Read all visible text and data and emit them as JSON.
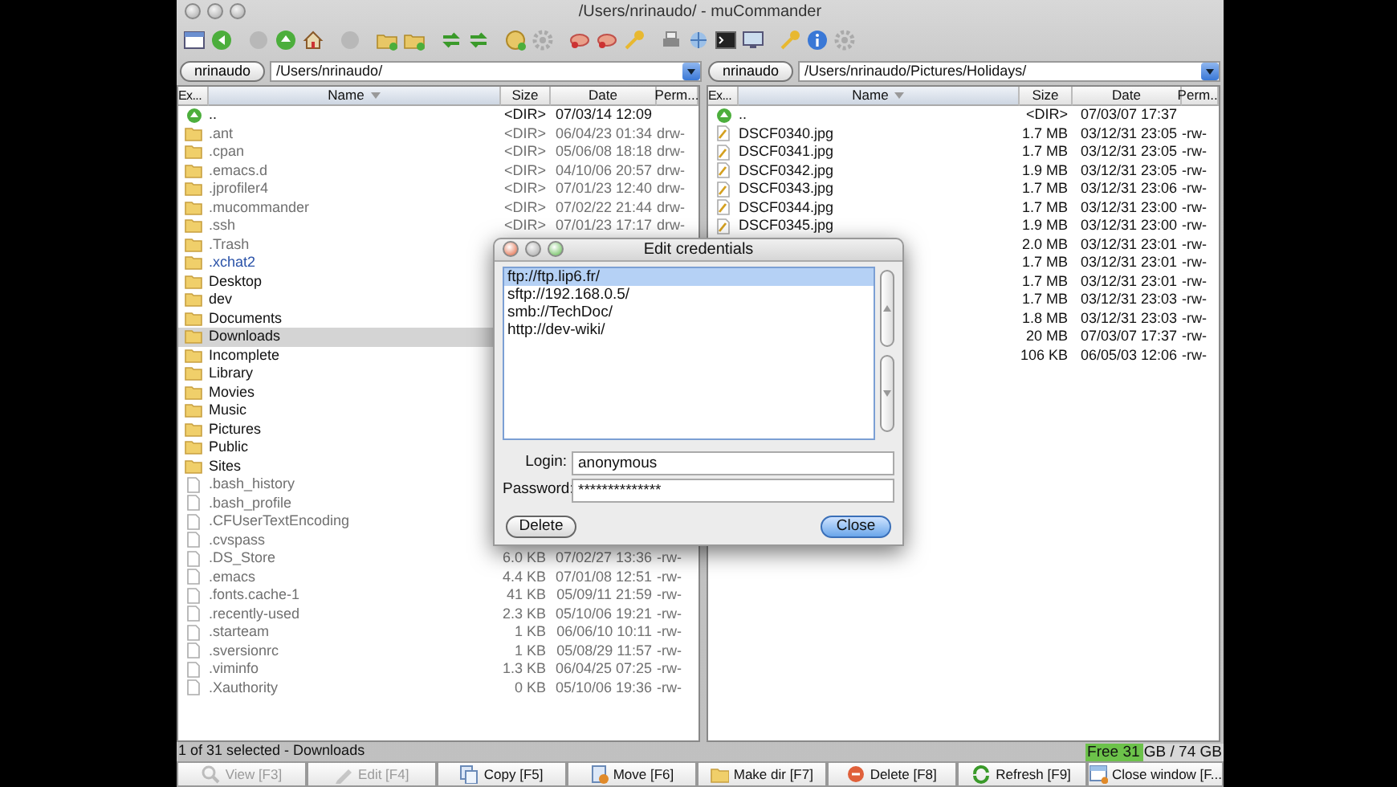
{
  "window": {
    "title": "/Users/nrinaudo/ - muCommander"
  },
  "panels": [
    {
      "volume": "nrinaudo",
      "path": "/Users/nrinaudo/",
      "columns": [
        {
          "label": "Ex...",
          "sorted": false
        },
        {
          "label": "Name",
          "sorted": true
        },
        {
          "label": "Size",
          "sorted": false
        },
        {
          "label": "Date",
          "sorted": false
        },
        {
          "label": "Perm...",
          "sorted": false
        }
      ],
      "rows": [
        {
          "kind": "parent",
          "hidden": false,
          "link": false,
          "name": "..",
          "size": "<DIR>",
          "date": "07/03/14 12:09",
          "selected": false
        },
        {
          "kind": "folder",
          "hidden": true,
          "link": false,
          "name": ".ant",
          "size": "<DIR>",
          "date": "06/04/23 01:34",
          "permissions": "drw-",
          "selected": false
        },
        {
          "kind": "folder",
          "hidden": true,
          "link": false,
          "name": ".cpan",
          "size": "<DIR>",
          "date": "05/06/08 18:18",
          "permissions": "drw-",
          "selected": false
        },
        {
          "kind": "folder",
          "hidden": true,
          "link": false,
          "name": ".emacs.d",
          "size": "<DIR>",
          "date": "04/10/06 20:57",
          "permissions": "drw-",
          "selected": false
        },
        {
          "kind": "folder",
          "hidden": true,
          "link": false,
          "name": ".jprofiler4",
          "size": "<DIR>",
          "date": "07/01/23 12:40",
          "permissions": "drw-",
          "selected": false
        },
        {
          "kind": "folder",
          "hidden": true,
          "link": false,
          "name": ".mucommander",
          "size": "<DIR>",
          "date": "07/02/22 21:44",
          "permissions": "drw-",
          "selected": false
        },
        {
          "kind": "folder",
          "hidden": true,
          "link": false,
          "name": ".ssh",
          "size": "<DIR>",
          "date": "07/01/23 17:17",
          "permissions": "drw-",
          "selected": false
        },
        {
          "kind": "folder",
          "hidden": true,
          "link": false,
          "name": ".Trash",
          "selected": false
        },
        {
          "kind": "folder",
          "hidden": false,
          "link": true,
          "name": ".xchat2",
          "selected": false
        },
        {
          "kind": "folder",
          "hidden": false,
          "link": false,
          "name": "Desktop",
          "selected": false
        },
        {
          "kind": "folder",
          "hidden": false,
          "link": false,
          "name": "dev",
          "selected": false
        },
        {
          "kind": "folder",
          "hidden": false,
          "link": false,
          "name": "Documents",
          "selected": false
        },
        {
          "kind": "folder",
          "hidden": false,
          "link": false,
          "name": "Downloads",
          "selected": true
        },
        {
          "kind": "folder",
          "hidden": false,
          "link": false,
          "name": "Incomplete",
          "selected": false
        },
        {
          "kind": "folder",
          "hidden": false,
          "link": false,
          "name": "Library",
          "selected": false
        },
        {
          "kind": "folder",
          "hidden": false,
          "link": false,
          "name": "Movies",
          "selected": false
        },
        {
          "kind": "folder",
          "hidden": false,
          "link": false,
          "name": "Music",
          "selected": false
        },
        {
          "kind": "folder",
          "hidden": false,
          "link": false,
          "name": "Pictures",
          "selected": false
        },
        {
          "kind": "folder",
          "hidden": false,
          "link": false,
          "name": "Public",
          "selected": false
        },
        {
          "kind": "folder",
          "hidden": false,
          "link": false,
          "name": "Sites",
          "selected": false
        },
        {
          "kind": "file",
          "hidden": true,
          "link": false,
          "name": ".bash_history",
          "selected": false
        },
        {
          "kind": "file",
          "hidden": true,
          "link": false,
          "name": ".bash_profile",
          "selected": false
        },
        {
          "kind": "file",
          "hidden": true,
          "link": false,
          "name": ".CFUserTextEncoding",
          "selected": false
        },
        {
          "kind": "file",
          "hidden": true,
          "link": false,
          "name": ".cvspass",
          "selected": false
        },
        {
          "kind": "file",
          "hidden": true,
          "link": false,
          "name": ".DS_Store",
          "size": "6.0 KB",
          "date": "07/02/27 13:36",
          "permissions": "-rw-",
          "selected": false
        },
        {
          "kind": "file",
          "hidden": true,
          "link": false,
          "name": ".emacs",
          "size": "4.4 KB",
          "date": "07/01/08 12:51",
          "permissions": "-rw-",
          "selected": false
        },
        {
          "kind": "file",
          "hidden": true,
          "link": false,
          "name": ".fonts.cache-1",
          "size": "41 KB",
          "date": "05/09/11 21:59",
          "permissions": "-rw-",
          "selected": false
        },
        {
          "kind": "file",
          "hidden": true,
          "link": false,
          "name": ".recently-used",
          "size": "2.3 KB",
          "date": "05/10/06 19:21",
          "permissions": "-rw-",
          "selected": false
        },
        {
          "kind": "file",
          "hidden": true,
          "link": false,
          "name": ".starteam",
          "size": "1 KB",
          "date": "06/06/10 10:11",
          "permissions": "-rw-",
          "selected": false
        },
        {
          "kind": "file",
          "hidden": true,
          "link": false,
          "name": ".sversionrc",
          "size": "1 KB",
          "date": "05/08/29 11:57",
          "permissions": "-rw-",
          "selected": false
        },
        {
          "kind": "file",
          "hidden": true,
          "link": false,
          "name": ".viminfo",
          "size": "1.3 KB",
          "date": "06/04/25 07:25",
          "permissions": "-rw-",
          "selected": false
        },
        {
          "kind": "file",
          "hidden": true,
          "link": false,
          "name": ".Xauthority",
          "size": "0 KB",
          "date": "05/10/06 19:36",
          "permissions": "-rw-",
          "selected": false
        }
      ]
    },
    {
      "volume": "nrinaudo",
      "path": "/Users/nrinaudo/Pictures/Holidays/",
      "columns": [
        {
          "label": "Ex...",
          "sorted": false
        },
        {
          "label": "Name",
          "sorted": true
        },
        {
          "label": "Size",
          "sorted": false
        },
        {
          "label": "Date",
          "sorted": false
        },
        {
          "label": "Perm...",
          "sorted": false
        }
      ],
      "rows": [
        {
          "kind": "parent",
          "hidden": false,
          "link": false,
          "name": "..",
          "size": "<DIR>",
          "date": "07/03/07 17:37",
          "selected": false
        },
        {
          "kind": "image",
          "hidden": false,
          "link": false,
          "name": "DSCF0340.jpg",
          "size": "1.7 MB",
          "date": "03/12/31 23:05",
          "permissions": "-rw-",
          "selected": false
        },
        {
          "kind": "image",
          "hidden": false,
          "link": false,
          "name": "DSCF0341.jpg",
          "size": "1.7 MB",
          "date": "03/12/31 23:05",
          "permissions": "-rw-",
          "selected": false
        },
        {
          "kind": "image",
          "hidden": false,
          "link": false,
          "name": "DSCF0342.jpg",
          "size": "1.9 MB",
          "date": "03/12/31 23:05",
          "permissions": "-rw-",
          "selected": false
        },
        {
          "kind": "image",
          "hidden": false,
          "link": false,
          "name": "DSCF0343.jpg",
          "size": "1.7 MB",
          "date": "03/12/31 23:06",
          "permissions": "-rw-",
          "selected": false
        },
        {
          "kind": "image",
          "hidden": false,
          "link": false,
          "name": "DSCF0344.jpg",
          "size": "1.7 MB",
          "date": "03/12/31 23:00",
          "permissions": "-rw-",
          "selected": false
        },
        {
          "kind": "image",
          "hidden": false,
          "link": false,
          "name": "DSCF0345.jpg",
          "size": "1.9 MB",
          "date": "03/12/31 23:00",
          "permissions": "-rw-",
          "selected": false
        },
        {
          "size": "2.0 MB",
          "date": "03/12/31 23:01",
          "permissions": "-rw-",
          "selected": false
        },
        {
          "size": "1.7 MB",
          "date": "03/12/31 23:01",
          "permissions": "-rw-",
          "selected": false
        },
        {
          "size": "1.7 MB",
          "date": "03/12/31 23:01",
          "permissions": "-rw-",
          "selected": false
        },
        {
          "size": "1.7 MB",
          "date": "03/12/31 23:03",
          "permissions": "-rw-",
          "selected": false
        },
        {
          "size": "1.8 MB",
          "date": "03/12/31 23:03",
          "permissions": "-rw-",
          "selected": false
        },
        {
          "size": "20 MB",
          "date": "07/03/07 17:37",
          "permissions": "-rw-",
          "selected": false
        },
        {
          "size": "106 KB",
          "date": "06/05/03 12:06",
          "permissions": "-rw-",
          "selected": false
        }
      ]
    }
  ],
  "dialog": {
    "title": "Edit credentials",
    "items": [
      {
        "label": "ftp://ftp.lip6.fr/",
        "selected": true
      },
      {
        "label": "sftp://192.168.0.5/",
        "selected": false
      },
      {
        "label": "smb://TechDoc/",
        "selected": false
      },
      {
        "label": "http://dev-wiki/",
        "selected": false
      }
    ],
    "fields": [
      {
        "label": "Login:",
        "value": "anonymous"
      },
      {
        "label": "Password:",
        "value": "**************"
      }
    ],
    "buttons": [
      {
        "label": "Delete",
        "default": false
      },
      {
        "label": "Close",
        "default": true
      }
    ]
  },
  "status_bar": {
    "text": "1 of 31 selected - Downloads",
    "free_space": {
      "text": "Free 31 GB / 74 GB",
      "level": 0.42
    }
  },
  "function_keys": [
    {
      "kind": "view",
      "label": "View [F3]",
      "disabled": true
    },
    {
      "kind": "edit",
      "label": "Edit [F4]",
      "disabled": true
    },
    {
      "kind": "copy",
      "label": "Copy [F5]",
      "disabled": false
    },
    {
      "kind": "move",
      "label": "Move [F6]",
      "disabled": false
    },
    {
      "kind": "mkdir",
      "label": "Make dir [F7]",
      "disabled": false
    },
    {
      "kind": "delete",
      "label": "Delete [F8]",
      "disabled": false
    },
    {
      "kind": "refresh",
      "label": "Refresh [F9]",
      "disabled": false
    },
    {
      "kind": "close",
      "label": "Close window [F...",
      "disabled": false
    }
  ]
}
